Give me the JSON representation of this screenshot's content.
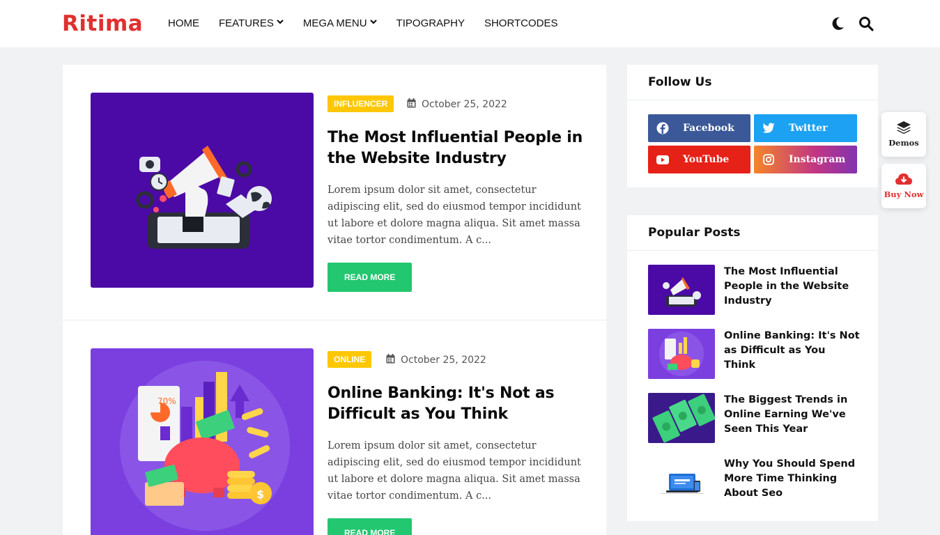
{
  "brand": {
    "logo_text": "Ritima",
    "color": "#e0302f"
  },
  "nav": {
    "items": [
      {
        "label": "HOME",
        "has_dropdown": false
      },
      {
        "label": "FEATURES",
        "has_dropdown": true
      },
      {
        "label": "MEGA MENU",
        "has_dropdown": true
      },
      {
        "label": "TIPOGRAPHY",
        "has_dropdown": false
      },
      {
        "label": "SHORTCODES",
        "has_dropdown": false
      }
    ],
    "icons": [
      "dark-mode-moon-icon",
      "search-icon"
    ]
  },
  "posts": [
    {
      "category": "INFLUENCER",
      "date": "October 25, 2022",
      "title": "The Most Influential People in the Website Industry",
      "excerpt": "Lorem ipsum dolor sit amet, consectetur adipiscing elit, sed do eiusmod tempor incididunt ut labore et dolore magna aliqua. Sit amet massa vitae tortor condimentum. A c...",
      "read_more": "READ MORE",
      "thumb_bg": "#4b0aa5"
    },
    {
      "category": "ONLINE",
      "date": "October 25, 2022",
      "title": "Online Banking: It's Not as Difficult as You Think",
      "excerpt": "Lorem ipsum dolor sit amet, consectetur adipiscing elit, sed do eiusmod tempor incididunt ut labore et dolore magna aliqua. Sit amet massa vitae tortor condimentum. A c...",
      "read_more": "READ MORE",
      "thumb_bg": "#7b3fe0"
    }
  ],
  "follow": {
    "title": "Follow Us",
    "buttons": [
      {
        "label": "Facebook",
        "color": "#3b5998",
        "icon": "facebook-icon"
      },
      {
        "label": "Twitter",
        "color": "#1da1f2",
        "icon": "twitter-icon"
      },
      {
        "label": "YouTube",
        "color": "#e62117",
        "icon": "youtube-icon"
      },
      {
        "label": "Instagram",
        "color": "#c13584",
        "icon": "instagram-icon"
      }
    ]
  },
  "popular": {
    "title": "Popular Posts",
    "items": [
      {
        "title": "The Most Influential People in the Website Industry"
      },
      {
        "title": "Online Banking: It's Not as Difficult as You Think"
      },
      {
        "title": "The Biggest Trends in Online Earning We've Seen This Year"
      },
      {
        "title": "Why You Should Spend More Time Thinking About Seo"
      }
    ]
  },
  "floating": {
    "demos_label": "Demos",
    "buy_label": "Buy Now",
    "buy_color": "#e0302f"
  },
  "colors": {
    "badge": "#ffc700",
    "read_more": "#22c770"
  }
}
